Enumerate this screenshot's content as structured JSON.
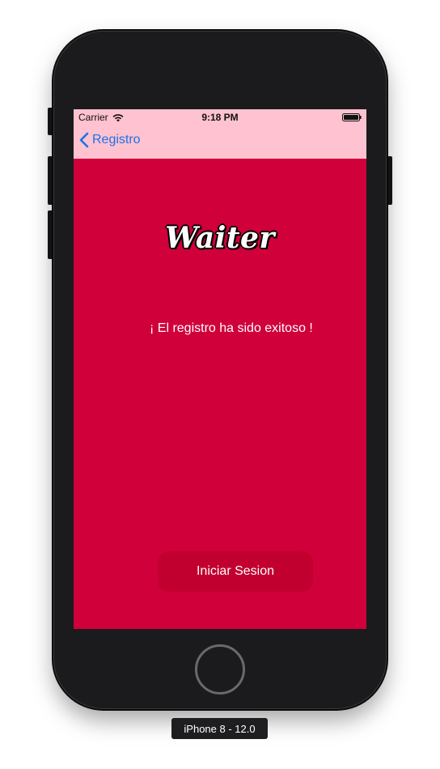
{
  "status_bar": {
    "carrier": "Carrier",
    "time": "9:18 PM",
    "wifi_icon": "wifi-icon",
    "battery_icon": "battery-icon"
  },
  "nav": {
    "back_label": "Registro",
    "back_icon": "chevron-left-icon"
  },
  "main": {
    "brand_title": "Waiter",
    "success_message": "¡ El registro ha sido exitoso !",
    "login_button_label": "Iniciar Sesion"
  },
  "simulator": {
    "device_label": "iPhone 8 - 12.0"
  },
  "colors": {
    "screen_background": "#d0003a",
    "nav_background": "#ffc2d0",
    "button_background": "#c2002f",
    "back_link": "#1a73e8",
    "device_body": "#1b1b1d"
  }
}
